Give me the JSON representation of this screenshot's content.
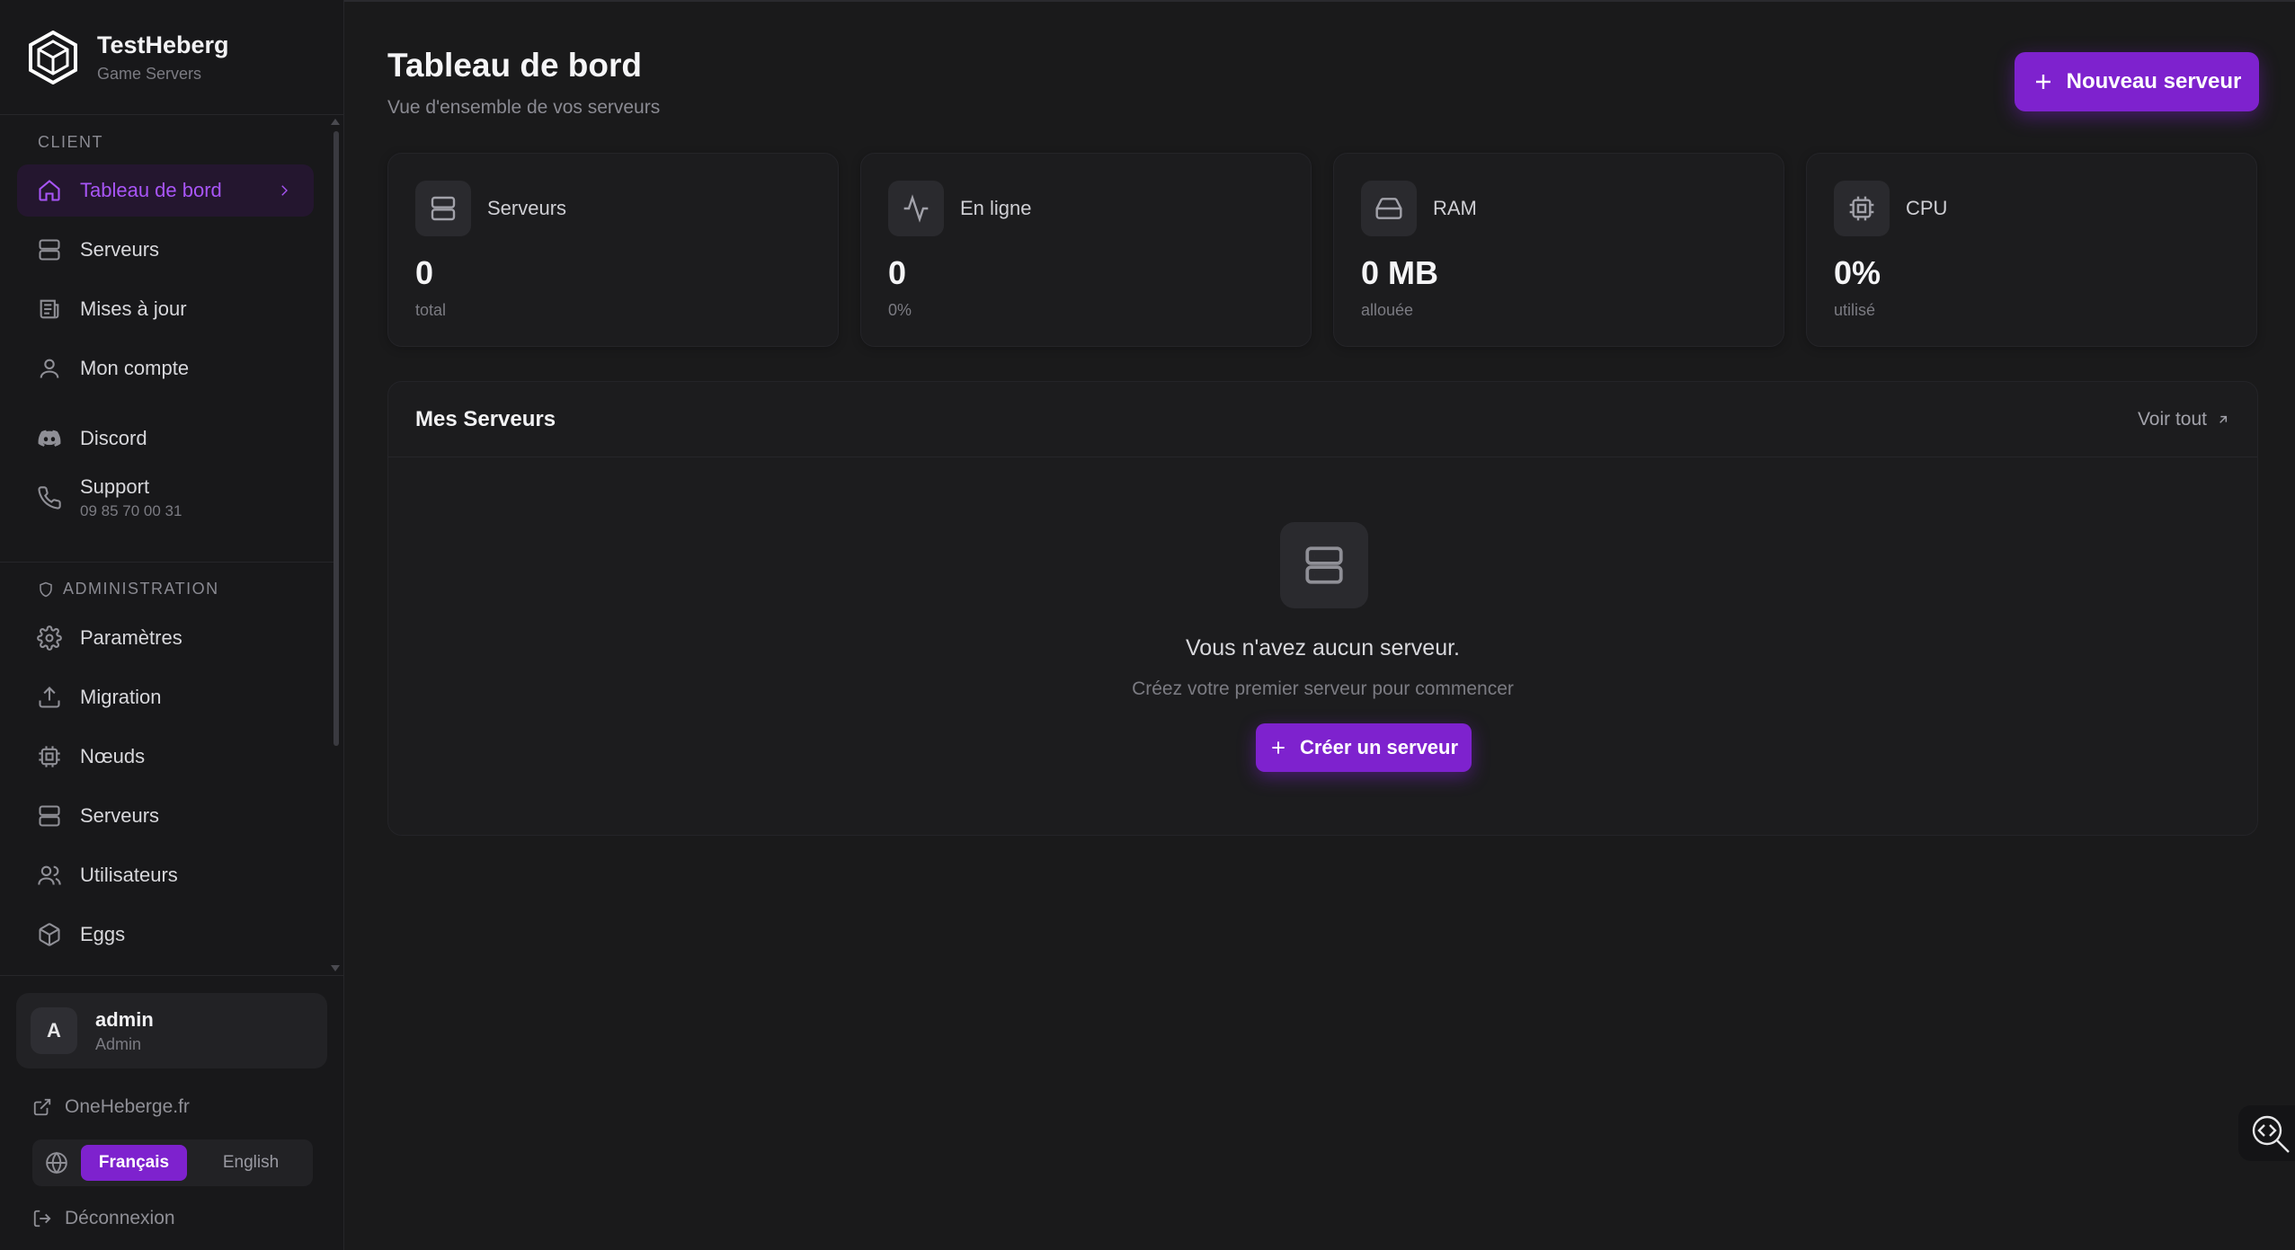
{
  "brand": {
    "name": "TestHeberg",
    "subtitle": "Game Servers"
  },
  "sidebar": {
    "client_label": "CLIENT",
    "client_items": [
      {
        "label": "Tableau de bord",
        "icon": "home-icon",
        "active": true
      },
      {
        "label": "Serveurs",
        "icon": "server-icon"
      },
      {
        "label": "Mises à jour",
        "icon": "newspaper-icon"
      },
      {
        "label": "Mon compte",
        "icon": "user-icon"
      },
      {
        "label": "Discord",
        "icon": "discord-icon"
      }
    ],
    "support": {
      "label": "Support",
      "phone": "09 85 70 00 31",
      "icon": "phone-icon"
    },
    "admin_label": "ADMINISTRATION",
    "admin_items": [
      {
        "label": "Paramètres",
        "icon": "gear-icon"
      },
      {
        "label": "Migration",
        "icon": "upload-icon"
      },
      {
        "label": "Nœuds",
        "icon": "cpu-icon"
      },
      {
        "label": "Serveurs",
        "icon": "server-icon"
      },
      {
        "label": "Utilisateurs",
        "icon": "users-icon"
      },
      {
        "label": "Eggs",
        "icon": "box-icon"
      }
    ]
  },
  "user": {
    "initial": "A",
    "name": "admin",
    "role": "Admin"
  },
  "footer": {
    "external_link": "OneHeberge.fr",
    "languages": {
      "fr": "Français",
      "en": "English",
      "selected": "fr"
    },
    "logout": "Déconnexion"
  },
  "header": {
    "title": "Tableau de bord",
    "subtitle": "Vue d'ensemble de vos serveurs",
    "new_server_button": "Nouveau serveur"
  },
  "stats": [
    {
      "label": "Serveurs",
      "value": "0",
      "sub": "total",
      "icon": "server-icon"
    },
    {
      "label": "En ligne",
      "value": "0",
      "sub": "0%",
      "icon": "activity-icon"
    },
    {
      "label": "RAM",
      "value": "0 MB",
      "sub": "allouée",
      "icon": "hard-drive-icon"
    },
    {
      "label": "CPU",
      "value": "0%",
      "sub": "utilisé",
      "icon": "cpu-icon"
    }
  ],
  "servers_panel": {
    "title": "Mes Serveurs",
    "see_all": "Voir tout",
    "empty_title": "Vous n'avez aucun serveur.",
    "empty_subtitle": "Créez votre premier serveur pour commencer",
    "create_button": "Créer un serveur"
  },
  "colors": {
    "accent": "#7e22ce",
    "accent_text": "#a855f7",
    "background": "#1a1a1b"
  }
}
